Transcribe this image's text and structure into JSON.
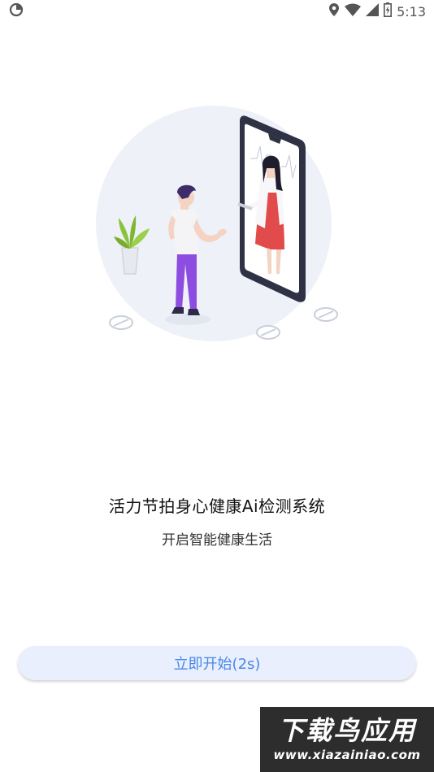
{
  "status_bar": {
    "time": "5:13",
    "icons": [
      "app-notification-icon",
      "location-icon",
      "wifi-icon",
      "cellular-signal-icon",
      "battery-icon"
    ]
  },
  "splash": {
    "title": "活力节拍身心健康Ai检测系统",
    "subtitle": "开启智能健康生活",
    "start_button_label": "立即开始(2s)"
  },
  "watermark": {
    "text": "下载鸟应用",
    "url": "www.xiazainiao.com"
  },
  "colors": {
    "accent": "#4a88e8",
    "button_bg": "#e9effc",
    "illustration_circle": "#eef1f8",
    "shirt_purple": "#8d4de0",
    "dress_red": "#e24b4b",
    "plant_green": "#8ac43f"
  }
}
